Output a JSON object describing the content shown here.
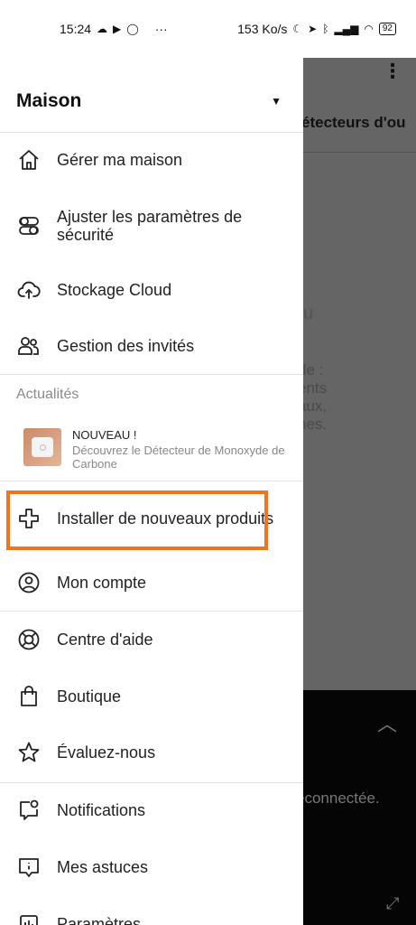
{
  "status_bar": {
    "time": "15:24",
    "dots": "···",
    "speed": "153 Ko/s",
    "battery": "92"
  },
  "drawer": {
    "home_name": "Maison",
    "menu_top": [
      {
        "label": "Gérer ma maison",
        "icon": "house-icon"
      },
      {
        "label": "Ajuster les paramètres de sécurité",
        "icon": "toggles-icon"
      },
      {
        "label": "Stockage Cloud",
        "icon": "cloud-upload-icon"
      },
      {
        "label": "Gestion des invités",
        "icon": "users-icon"
      }
    ],
    "news_section": {
      "label": "Actualités",
      "item": {
        "title": "NOUVEAU !",
        "text": "Découvrez le Détecteur de Monoxyde de Carbone"
      }
    },
    "install": {
      "label": "Installer de nouveaux produits",
      "icon": "plus-icon"
    },
    "account": {
      "label": "Mon compte",
      "icon": "account-icon"
    },
    "menu_mid": [
      {
        "label": "Centre d'aide",
        "icon": "lifebuoy-icon"
      },
      {
        "label": "Boutique",
        "icon": "shopping-bag-icon"
      },
      {
        "label": "Évaluez-nous",
        "icon": "star-icon"
      }
    ],
    "menu_bottom": [
      {
        "label": "Notifications",
        "icon": "notification-icon"
      },
      {
        "label": "Mes astuces",
        "icon": "tips-icon"
      },
      {
        "label": "Paramètres",
        "icon": "settings-icon"
      }
    ],
    "highlight_color": "#f5731d"
  },
  "background": {
    "tab_title": "étecteurs d'ou",
    "partial_char": "u",
    "partial_text": "de :\nents\naux,\nnes.",
    "disconnected": "éconnectée."
  }
}
